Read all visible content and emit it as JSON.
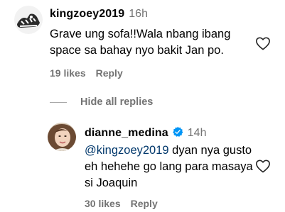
{
  "comments": [
    {
      "username": "kingzoey2019",
      "time": "16h",
      "text": "Grave ung sofa!!Wala nbang ibang space sa bahay nyo bakit Jan po.",
      "likes": "19 likes",
      "reply_label": "Reply",
      "verified": false
    },
    {
      "username": "dianne_medina",
      "time": "14h",
      "mention": "@kingzoey2019",
      "text": " dyan nya gusto eh hehehe go lang para masaya si Joaquin",
      "likes": "30 likes",
      "reply_label": "Reply",
      "verified": true
    }
  ],
  "replies_toggle": {
    "label": "Hide all replies"
  },
  "colors": {
    "secondary_text": "#737373",
    "mention": "#00376b",
    "verified_badge": "#0095f6"
  },
  "icons": {
    "like": "heart-outline-icon",
    "verified": "verified-badge-icon"
  }
}
